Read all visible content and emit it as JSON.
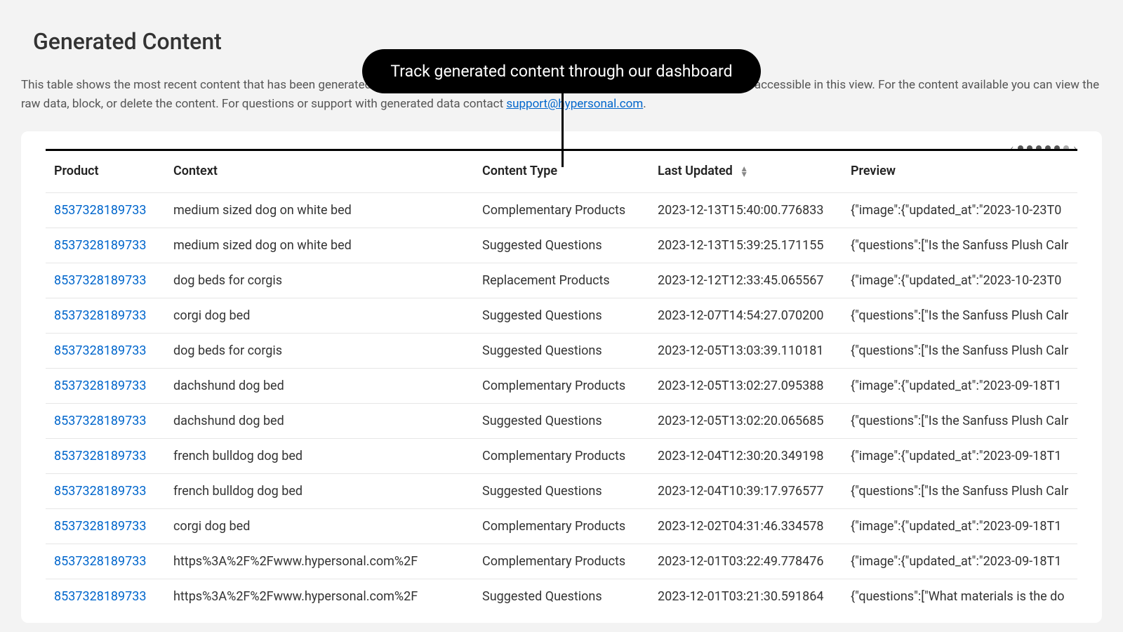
{
  "page_title": "Generated Content",
  "callout": "Track generated content through our dashboard",
  "description_pre": "This table shows the most recent content that has been generated by Hypersonal for your store. Over time we will be making more content accessible in this view. For the content available you can view the raw data, block, or delete the content. For questions or support with generated data contact ",
  "support_email": "support@hypersonal.com",
  "description_post": ".",
  "columns": {
    "product": "Product",
    "context": "Context",
    "type": "Content Type",
    "updated": "Last Updated",
    "preview": "Preview"
  },
  "rows": [
    {
      "product": "8537328189733",
      "context": "medium sized dog on white bed",
      "type": "Complementary Products",
      "updated": "2023-12-13T15:40:00.776833",
      "preview": "{\"image\":{\"updated_at\":\"2023-10-23T0"
    },
    {
      "product": "8537328189733",
      "context": "medium sized dog on white bed",
      "type": "Suggested Questions",
      "updated": "2023-12-13T15:39:25.171155",
      "preview": "{\"questions\":[\"Is the Sanfuss Plush Calr"
    },
    {
      "product": "8537328189733",
      "context": "dog beds for corgis",
      "type": "Replacement Products",
      "updated": "2023-12-12T12:33:45.065567",
      "preview": "{\"image\":{\"updated_at\":\"2023-10-23T0"
    },
    {
      "product": "8537328189733",
      "context": "corgi dog bed",
      "type": "Suggested Questions",
      "updated": "2023-12-07T14:54:27.070200",
      "preview": "{\"questions\":[\"Is the Sanfuss Plush Calr"
    },
    {
      "product": "8537328189733",
      "context": "dog beds for corgis",
      "type": "Suggested Questions",
      "updated": "2023-12-05T13:03:39.110181",
      "preview": "{\"questions\":[\"Is the Sanfuss Plush Calr"
    },
    {
      "product": "8537328189733",
      "context": "dachshund dog bed",
      "type": "Complementary Products",
      "updated": "2023-12-05T13:02:27.095388",
      "preview": "{\"image\":{\"updated_at\":\"2023-09-18T1"
    },
    {
      "product": "8537328189733",
      "context": "dachshund dog bed",
      "type": "Suggested Questions",
      "updated": "2023-12-05T13:02:20.065685",
      "preview": "{\"questions\":[\"Is the Sanfuss Plush Calr"
    },
    {
      "product": "8537328189733",
      "context": "french bulldog dog bed",
      "type": "Complementary Products",
      "updated": "2023-12-04T12:30:20.349198",
      "preview": "{\"image\":{\"updated_at\":\"2023-09-18T1"
    },
    {
      "product": "8537328189733",
      "context": "french bulldog dog bed",
      "type": "Suggested Questions",
      "updated": "2023-12-04T10:39:17.976577",
      "preview": "{\"questions\":[\"Is the Sanfuss Plush Calr"
    },
    {
      "product": "8537328189733",
      "context": "corgi dog bed",
      "type": "Complementary Products",
      "updated": "2023-12-02T04:31:46.334578",
      "preview": "{\"image\":{\"updated_at\":\"2023-09-18T1"
    },
    {
      "product": "8537328189733",
      "context": "https%3A%2F%2Fwww.hypersonal.com%2F",
      "type": "Complementary Products",
      "updated": "2023-12-01T03:22:49.778476",
      "preview": "{\"image\":{\"updated_at\":\"2023-09-18T1"
    },
    {
      "product": "8537328189733",
      "context": "https%3A%2F%2Fwww.hypersonal.com%2F",
      "type": "Suggested Questions",
      "updated": "2023-12-01T03:21:30.591864",
      "preview": "{\"questions\":[\"What materials is the do"
    }
  ]
}
